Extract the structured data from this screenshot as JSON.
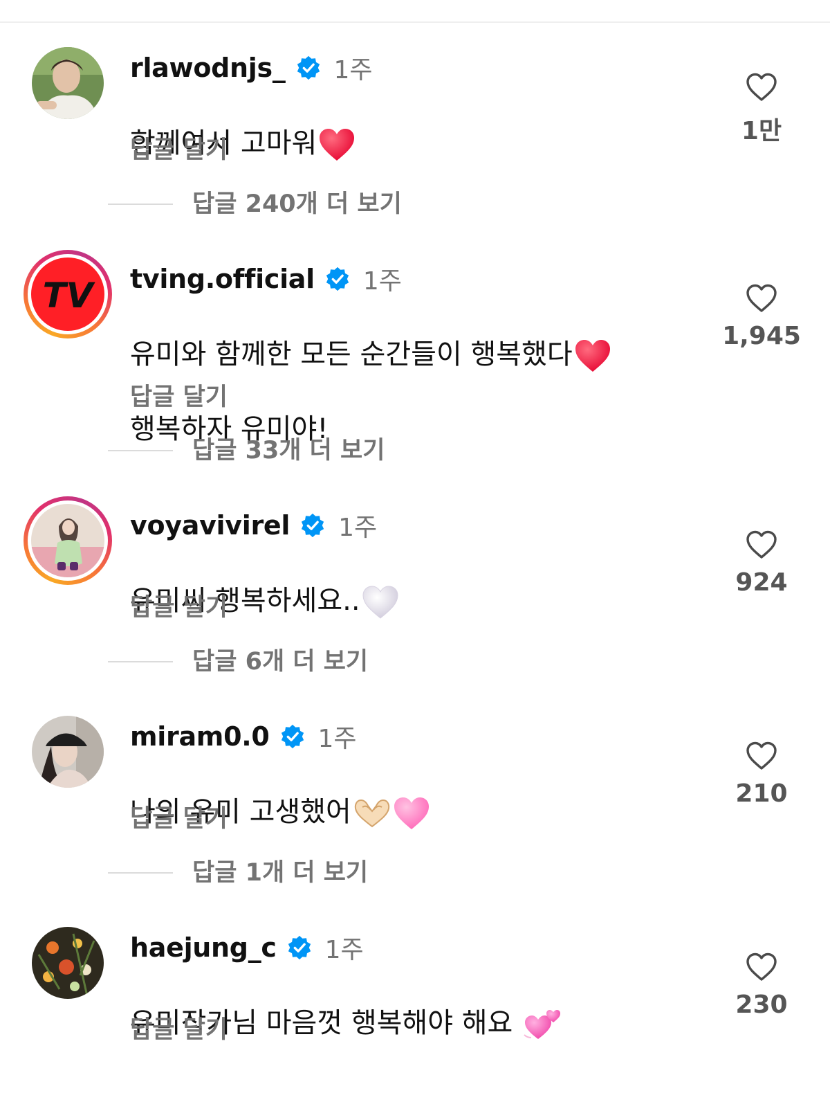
{
  "comments": [
    {
      "username": "rlawodnjs_",
      "time": "1주",
      "text": "함께여서 고마워",
      "emoji": "red-heart",
      "reply_label": "답글 달기",
      "likes": "1만",
      "more_replies": "답글 240개 더 보기"
    },
    {
      "username": "tving.official",
      "time": "1주",
      "text": "유미와 함께한 모든 순간들이 행복했다",
      "text_line2": "행복하자 유미야!",
      "emoji": "red-heart",
      "reply_label": "답글 달기",
      "likes": "1,945",
      "more_replies": "답글 33개 더 보기"
    },
    {
      "username": "voyavivirel",
      "time": "1주",
      "text": "유미씨 행복하세요..",
      "emoji": "white-heart",
      "reply_label": "답글 달기",
      "likes": "924",
      "more_replies": "답글 6개 더 보기"
    },
    {
      "username": "miram0.0",
      "time": "1주",
      "text": "나의 유미 고생했어",
      "emoji": "heart-hands-pink-heart",
      "reply_label": "답글 달기",
      "likes": "210",
      "more_replies": "답글 1개 더 보기"
    },
    {
      "username": "haejung_c",
      "time": "1주",
      "text": "유미작가님 마음껏 행복해야 해요 ",
      "emoji": "two-hearts",
      "reply_label": "답글 달기",
      "likes": "230"
    }
  ],
  "colors": {
    "verified": "#0095f6",
    "muted": "#737373",
    "red_heart": "#ff1744"
  },
  "logo_text": "TV"
}
